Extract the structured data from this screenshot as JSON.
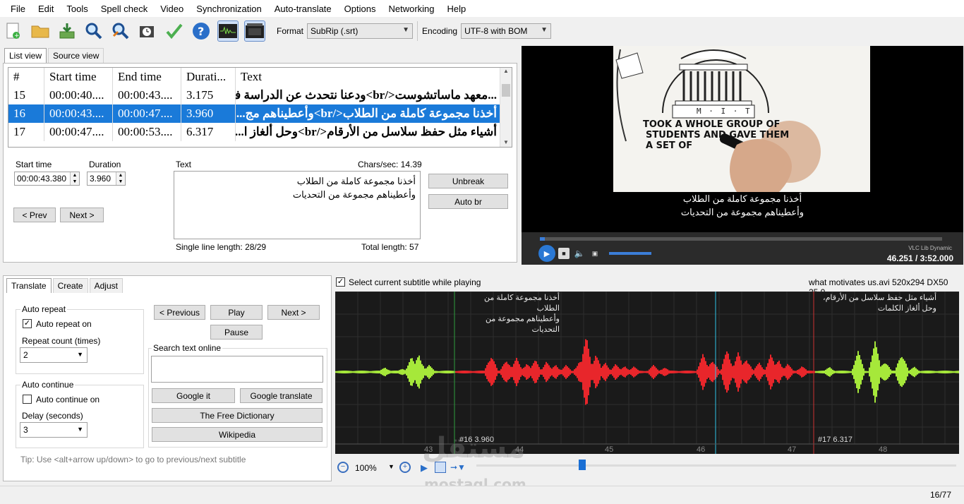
{
  "menu": [
    "File",
    "Edit",
    "Tools",
    "Spell check",
    "Video",
    "Synchronization",
    "Auto-translate",
    "Options",
    "Networking",
    "Help"
  ],
  "toolbar": {
    "icons": [
      "new-file-icon",
      "open-folder-icon",
      "download-icon",
      "find-icon",
      "replace-icon",
      "visual-sync-icon",
      "spell-check-icon",
      "help-icon",
      "waveform-toggle-icon",
      "video-toggle-icon"
    ],
    "format_label": "Format",
    "format_value": "SubRip (.srt)",
    "encoding_label": "Encoding",
    "encoding_value": "UTF-8 with BOM"
  },
  "view_tabs": [
    "List view",
    "Source view"
  ],
  "grid": {
    "headers": [
      "#",
      "Start time",
      "End time",
      "Durati...",
      "Text"
    ],
    "rows": [
      {
        "num": "15",
        "start": "00:00:40....",
        "end": "00:00:43....",
        "dur": "3.175",
        "text": "...معهد ماساتشوست</br>ودعنا نتحدث عن الدراسة في"
      },
      {
        "num": "16",
        "start": "00:00:43....",
        "end": "00:00:47....",
        "dur": "3.960",
        "text": "أخذنا مجموعة كاملة من الطلاب</br>وأعطيناهم مج..."
      },
      {
        "num": "17",
        "start": "00:00:47....",
        "end": "00:00:53....",
        "dur": "6.317",
        "text": "أشياء مثل حفظ سلاسل من الأرقام</br>وحل ألغاز ا..."
      }
    ]
  },
  "editor": {
    "start_time_label": "Start time",
    "start_time_value": "00:00:43.380",
    "duration_label": "Duration",
    "duration_value": "3.960",
    "text_label": "Text",
    "chars_sec": "Chars/sec: 14.39",
    "text_line1": "أخذنا مجموعة كاملة من الطلاب",
    "text_line2": "وأعطيناهم مجموعة من التحديات",
    "prev_button": "< Prev",
    "next_button": "Next >",
    "unbreak_button": "Unbreak",
    "autobr_button": "Auto br",
    "single_line_length": "Single line length: 28/29",
    "total_length": "Total length: 57"
  },
  "video": {
    "banner_line1": "TOOK A WHOLE GROUP OF",
    "banner_line2": "STUDENTS AND GAVE THEM",
    "banner_line3": "A SET OF",
    "sign": "M · I · T",
    "subtitle_line1": "أخذنا مجموعة كاملة من الطلاب",
    "subtitle_line2": "وأعطيناهم مجموعة من التحديات",
    "time": "46.251 / 3:52.000",
    "lib": "VLC Lib Dynamic",
    "progress": 0.012
  },
  "bottom_tabs": [
    "Translate",
    "Create",
    "Adjust"
  ],
  "translate": {
    "auto_repeat_title": "Auto repeat",
    "auto_repeat_on": "Auto repeat on",
    "repeat_count_label": "Repeat count (times)",
    "repeat_count_value": "2",
    "auto_continue_title": "Auto continue",
    "auto_continue_on": "Auto continue on",
    "delay_label": "Delay (seconds)",
    "delay_value": "3",
    "previous_button": "< Previous",
    "play_button": "Play",
    "next_button": "Next >",
    "pause_button": "Pause",
    "search_title": "Search text online",
    "google_it": "Google it",
    "google_translate": "Google translate",
    "free_dictionary": "The Free Dictionary",
    "wikipedia": "Wikipedia",
    "tip": "Tip: Use <alt+arrow up/down> to go to previous/next subtitle"
  },
  "waveform": {
    "select_current_label": "Select current subtitle while playing",
    "file_info": "what motivates us.avi 520x294 DX50 25.0",
    "sub16_line1": "أخذنا مجموعة كاملة من الطلاب",
    "sub16_line2": "وأعطيناهم مجموعة من التحديات",
    "sub16_info": "#16  3.960",
    "sub17_line1": "أشياء مثل حفظ سلاسل من الأرقام،",
    "sub17_line2": "وحل ألغاز الكلمات",
    "sub17_info": "#17  6.317",
    "ticks": [
      "43",
      "44",
      "45",
      "46",
      "47",
      "48"
    ],
    "zoom": "100%"
  },
  "watermark": {
    "arabic": "مستقل",
    "latin": "mostaql.com"
  },
  "status": {
    "position": "16/77"
  },
  "colors": {
    "selected_row": "#1a7ad9",
    "wave_selected": "#e8262b",
    "wave_other": "#a6e83a",
    "accent": "#2a78d4"
  }
}
